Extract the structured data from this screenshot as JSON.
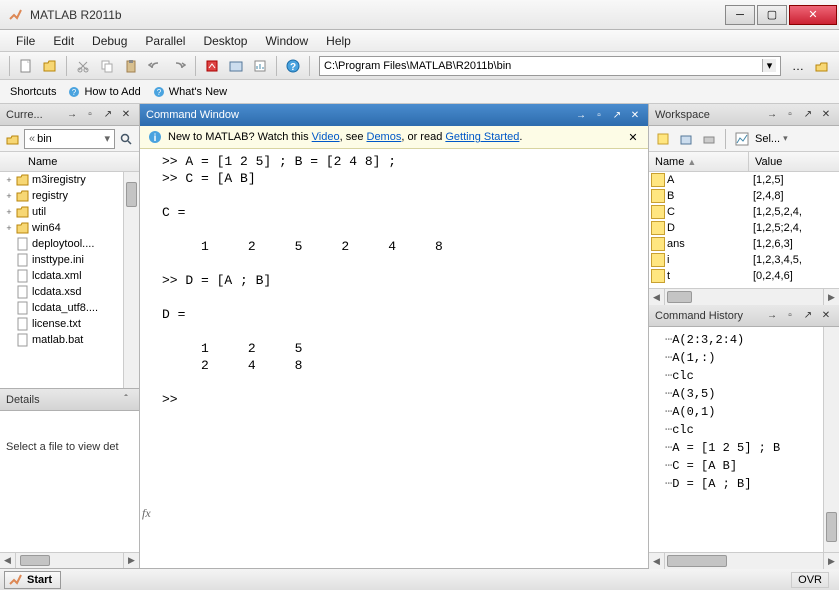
{
  "window": {
    "title": "MATLAB R2011b"
  },
  "menu": [
    "File",
    "Edit",
    "Debug",
    "Parallel",
    "Desktop",
    "Window",
    "Help"
  ],
  "path": "C:\\Program Files\\MATLAB\\R2011b\\bin",
  "shortcuts": {
    "label": "Shortcuts",
    "howto": "How to Add",
    "whatsnew": "What's New"
  },
  "panels": {
    "curfolder": "Curre...",
    "cmdwin": "Command Window",
    "workspace": "Workspace",
    "cmdhist": "Command History",
    "details": "Details"
  },
  "curfolder": {
    "crumb": "bin",
    "header": "Name",
    "items": [
      {
        "expand": "+",
        "type": "folder",
        "name": "m3iregistry"
      },
      {
        "expand": "+",
        "type": "folder",
        "name": "registry"
      },
      {
        "expand": "+",
        "type": "folder",
        "name": "util"
      },
      {
        "expand": "+",
        "type": "folder",
        "name": "win64"
      },
      {
        "expand": "",
        "type": "file",
        "name": "deploytool...."
      },
      {
        "expand": "",
        "type": "file",
        "name": "insttype.ini"
      },
      {
        "expand": "",
        "type": "file",
        "name": "lcdata.xml"
      },
      {
        "expand": "",
        "type": "file",
        "name": "lcdata.xsd"
      },
      {
        "expand": "",
        "type": "file",
        "name": "lcdata_utf8...."
      },
      {
        "expand": "",
        "type": "file",
        "name": "license.txt"
      },
      {
        "expand": "",
        "type": "file",
        "name": "matlab.bat"
      }
    ],
    "details_msg": "Select a file to view det"
  },
  "cmdwin": {
    "hint_pre": "New to MATLAB? Watch this ",
    "hint_video": "Video",
    "hint_mid1": ", see ",
    "hint_demos": "Demos",
    "hint_mid2": ", or read ",
    "hint_gs": "Getting Started",
    "hint_post": ".",
    "lines": ">> A = [1 2 5] ; B = [2 4 8] ;\n>> C = [A B]\n\nC =\n\n     1     2     5     2     4     8\n\n>> D = [A ; B]\n\nD =\n\n     1     2     5\n     2     4     8\n\n>> "
  },
  "workspace": {
    "sel": "Sel...",
    "hdr_name": "Name",
    "hdr_value": "Value",
    "vars": [
      {
        "name": "A",
        "value": "[1,2,5]"
      },
      {
        "name": "B",
        "value": "[2,4,8]"
      },
      {
        "name": "C",
        "value": "[1,2,5,2,4,"
      },
      {
        "name": "D",
        "value": "[1,2,5;2,4,"
      },
      {
        "name": "ans",
        "value": "[1,2,6,3]"
      },
      {
        "name": "i",
        "value": "[1,2,3,4,5,"
      },
      {
        "name": "t",
        "value": "[0,2,4,6]"
      }
    ]
  },
  "cmdhist": {
    "items": [
      "A(2:3,2:4)",
      "A(1,:)",
      "clc",
      "A(3,5)",
      "A(0,1)",
      "clc",
      "A = [1 2 5] ; B",
      "C = [A B]",
      "D = [A ; B]"
    ]
  },
  "status": {
    "start": "Start",
    "ovr": "OVR"
  }
}
